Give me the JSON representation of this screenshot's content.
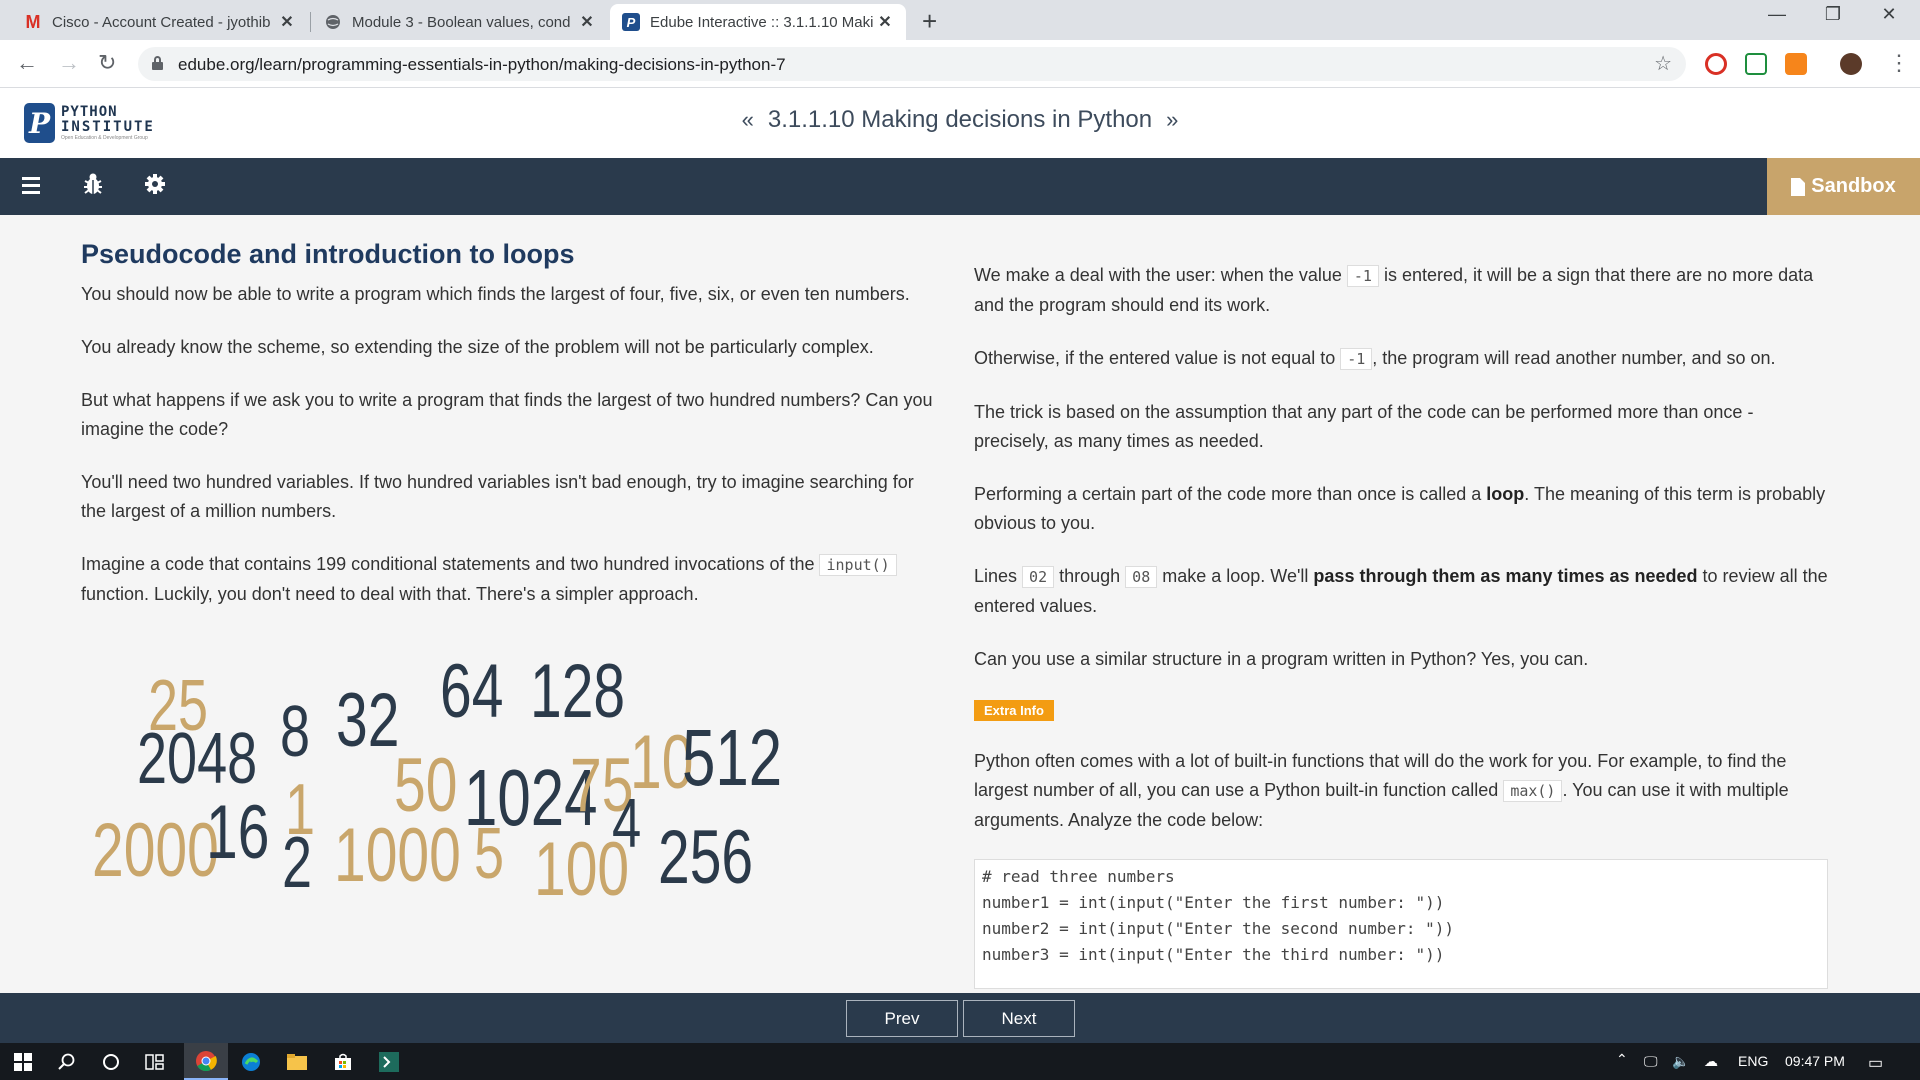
{
  "browser": {
    "tabs": [
      {
        "title": "Cisco - Account Created - jyothib",
        "icon": "gmail-icon"
      },
      {
        "title": "Module 3 - Boolean values, cond",
        "icon": "globe-icon"
      },
      {
        "title": "Edube Interactive :: 3.1.1.10 Maki",
        "icon": "python-institute-icon"
      }
    ],
    "url": "edube.org/learn/programming-essentials-in-python/making-decisions-in-python-7"
  },
  "site": {
    "logo_line1": "PYTHON",
    "logo_line2": "INSTITUTE",
    "logo_line3": "Open Education & Development Group",
    "lesson_title": "3.1.1.10 Making decisions in Python",
    "sandbox_label": "Sandbox"
  },
  "left": {
    "heading": "Pseudocode and introduction to loops",
    "p1": "You should now be able to write a program which finds the largest of four, five, six, or even ten numbers.",
    "p2": "You already know the scheme, so extending the size of the problem will not be particularly complex.",
    "p3": "But what happens if we ask you to write a program that finds the largest of two hundred numbers? Can you imagine the code?",
    "p4": "You'll need two hundred variables. If two hundred variables isn't bad enough, try to imagine searching for the largest of a million numbers.",
    "p5a": "Imagine a code that contains 199 conditional statements and two hundred invocations of the ",
    "p5code": "input()",
    "p5b": " function. Luckily, you don't need to deal with that. There's a simpler approach."
  },
  "numbers": [
    {
      "t": "25",
      "c": "gold"
    },
    {
      "t": "2048",
      "c": "dark"
    },
    {
      "t": "8",
      "c": "dark"
    },
    {
      "t": "32",
      "c": "dark"
    },
    {
      "t": "64",
      "c": "dark"
    },
    {
      "t": "128",
      "c": "dark"
    },
    {
      "t": "1",
      "c": "gold"
    },
    {
      "t": "50",
      "c": "gold"
    },
    {
      "t": "1024",
      "c": "dark"
    },
    {
      "t": "75",
      "c": "gold"
    },
    {
      "t": "10",
      "c": "gold"
    },
    {
      "t": "512",
      "c": "dark"
    },
    {
      "t": "2000",
      "c": "gold"
    },
    {
      "t": "16",
      "c": "dark"
    },
    {
      "t": "2",
      "c": "dark"
    },
    {
      "t": "1000",
      "c": "gold"
    },
    {
      "t": "5",
      "c": "gold"
    },
    {
      "t": "100",
      "c": "gold"
    },
    {
      "t": "4",
      "c": "dark"
    },
    {
      "t": "256",
      "c": "dark"
    }
  ],
  "right": {
    "p1a": "We make a deal with the user: when the value ",
    "p1code": "-1",
    "p1b": " is entered, it will be a sign that there are no more data and the program should end its work.",
    "p2a": "Otherwise, if the entered value is not equal to ",
    "p2code": "-1",
    "p2b": ", the program will read another number, and so on.",
    "p3": "The trick is based on the assumption that any part of the code can be performed more than once - precisely, as many times as needed.",
    "p4a": "Performing a certain part of the code more than once is called a ",
    "p4bold": "loop",
    "p4b": ". The meaning of this term is probably obvious to you.",
    "p5a": "Lines ",
    "p5code1": "02",
    "p5mid": " through ",
    "p5code2": "08",
    "p5b": " make a loop. We'll ",
    "p5bold": "pass through them as many times as needed",
    "p5c": " to review all the entered values.",
    "p6": "Can you use a similar structure in a program written in Python? Yes, you can.",
    "extra_badge": "Extra Info",
    "p7a": "Python often comes with a lot of built-in functions that will do the work for you. For example, to find the largest number of all, you can use a Python built-in function called ",
    "p7code": "max()",
    "p7b": ". You can use it with multiple arguments. Analyze the code below:",
    "code_lines": [
      "# read three numbers",
      "number1 = int(input(\"Enter the first number: \"))",
      "number2 = int(input(\"Enter the second number: \"))",
      "number3 = int(input(\"Enter the third number: \"))"
    ]
  },
  "footer": {
    "prev": "Prev",
    "next": "Next"
  },
  "taskbar": {
    "lang": "ENG",
    "time": "09:47 PM"
  },
  "colors": {
    "navy": "#2a3a4c",
    "gold": "#c8a46b",
    "heading": "#1f3a5f",
    "badge": "#f39c12"
  }
}
